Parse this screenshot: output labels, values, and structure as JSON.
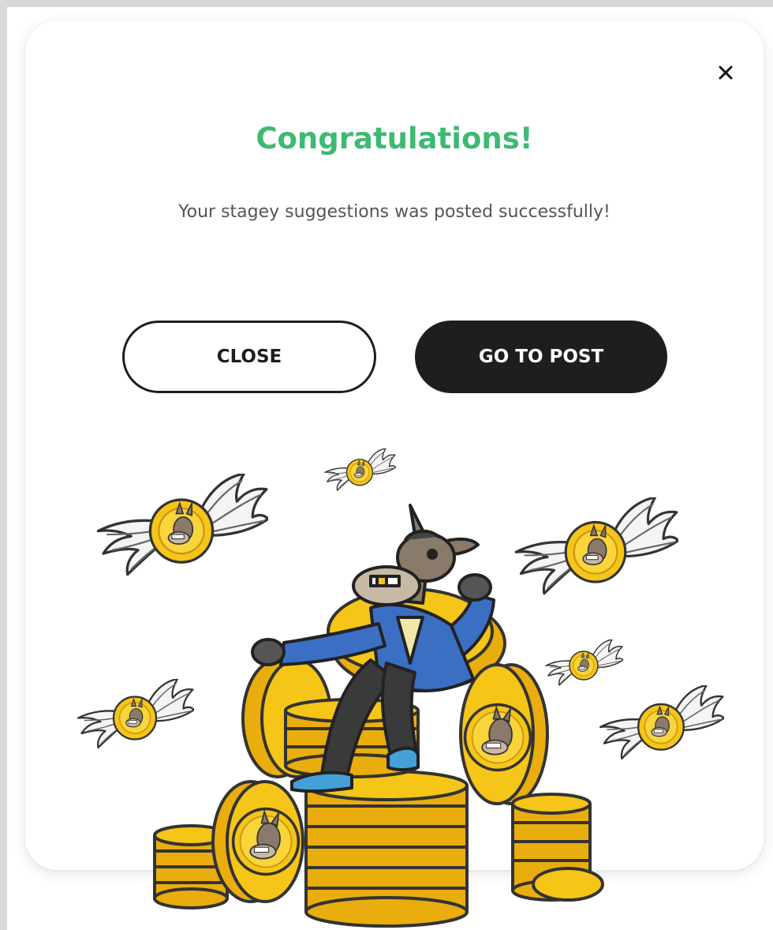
{
  "dialog": {
    "title": "Congratulations!",
    "message": "Your stagey suggestions was posted successfully!",
    "close_label": "CLOSE",
    "go_to_post_label": "GO TO POST",
    "close_icon": "close-icon"
  },
  "colors": {
    "title": "#3dba72",
    "primary_button": "#1e1e20",
    "coin": "#f5c518"
  },
  "illustration": {
    "subject": "mascot-on-coins"
  }
}
